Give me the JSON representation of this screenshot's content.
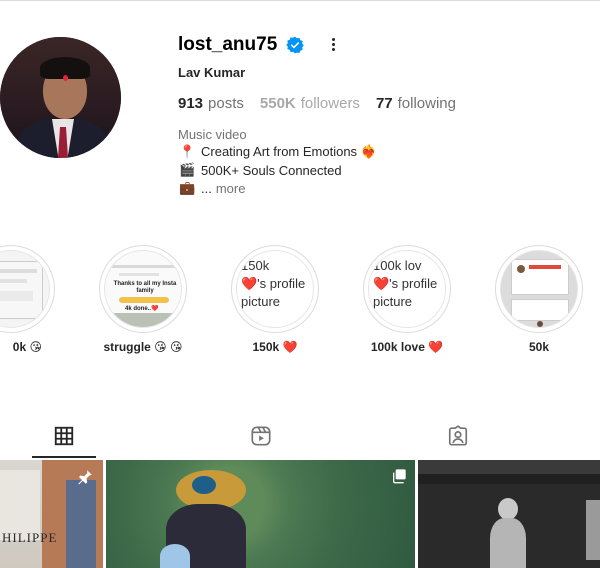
{
  "profile": {
    "username": "lost_anu75",
    "full_name": "Lav Kumar",
    "category": "Music video",
    "verified_color": "#0095f6",
    "stats": {
      "posts_count": "913",
      "posts_label": "posts",
      "followers_count": "550K",
      "followers_label": "followers",
      "following_count": "77",
      "following_label": "following"
    },
    "bio": [
      {
        "icon": "📍",
        "text": "Creating Art from Emotions ❤️‍🔥"
      },
      {
        "icon": "🎬",
        "text": "500K+ Souls Connected"
      },
      {
        "icon": "💼",
        "text": "...",
        "more": "more"
      }
    ]
  },
  "highlights": [
    {
      "label": "0k 😘",
      "thumb": "screenshot"
    },
    {
      "label": "struggle 😘 😘",
      "thumb": "screenshot-thanks",
      "thumb_text": "Thanks to all my Insta family",
      "thumb_sub": "4k done..❤️"
    },
    {
      "label": "150k ❤️",
      "thumb": "broken",
      "alt_a": "150k",
      "alt_b": "❤️'s profile",
      "alt_c": "picture"
    },
    {
      "label": "100k love ❤️",
      "thumb": "broken",
      "alt_a": "100k lov",
      "alt_b": "❤️'s profile",
      "alt_c": "picture"
    },
    {
      "label": "50k",
      "thumb": "screenshot"
    }
  ],
  "tabs": [
    {
      "name": "posts",
      "icon": "grid-icon",
      "active": true
    },
    {
      "name": "reels",
      "icon": "reels-icon",
      "active": false
    },
    {
      "name": "tagged",
      "icon": "tagged-icon",
      "active": false
    }
  ],
  "posts": [
    {
      "overlay_text": "HILIPPE"
    },
    {
      "overlay_text": ""
    },
    {
      "overlay_text": ""
    }
  ],
  "colors": {
    "heart": "#e8264b",
    "muted": "#737373",
    "text": "#262626"
  }
}
